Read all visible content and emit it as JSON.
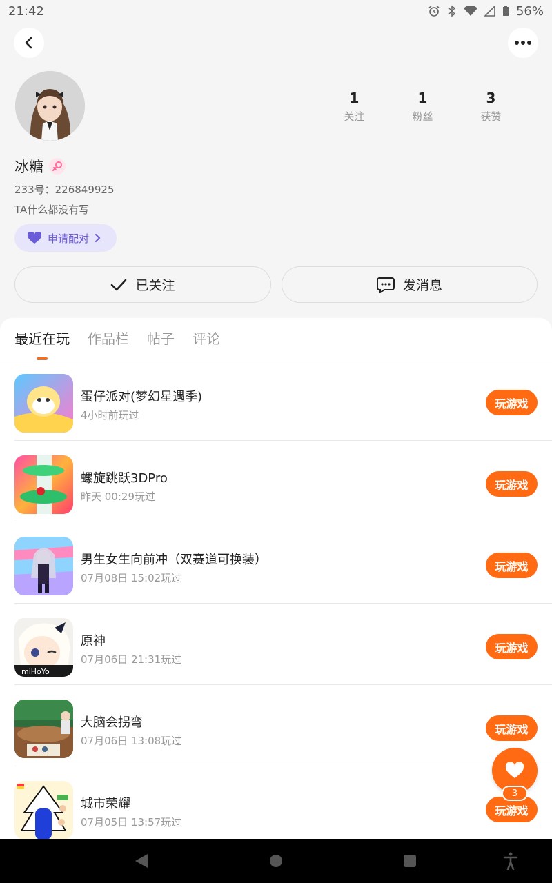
{
  "status_bar": {
    "time": "21:42",
    "battery": "56%"
  },
  "profile": {
    "username": "冰糖",
    "user_id": "233号：226849925",
    "bio": "TA什么都没有写",
    "pair_button": "申请配对",
    "stats": [
      {
        "value": "1",
        "label": "关注"
      },
      {
        "value": "1",
        "label": "粉丝"
      },
      {
        "value": "3",
        "label": "获赞"
      }
    ],
    "follow_button": "已关注",
    "message_button": "发消息"
  },
  "tabs": [
    {
      "label": "最近在玩",
      "active": true
    },
    {
      "label": "作品栏",
      "active": false
    },
    {
      "label": "帖子",
      "active": false
    },
    {
      "label": "评论",
      "active": false
    }
  ],
  "games": [
    {
      "name": "蛋仔派对(梦幻星遇季)",
      "time": "4小时前玩过",
      "button": "玩游戏"
    },
    {
      "name": "螺旋跳跃3DPro",
      "time": "昨天 00:29玩过",
      "button": "玩游戏"
    },
    {
      "name": "男生女生向前冲（双赛道可换装）",
      "time": "07月08日 15:02玩过",
      "button": "玩游戏"
    },
    {
      "name": "原神",
      "time": "07月06日 21:31玩过",
      "button": "玩游戏"
    },
    {
      "name": "大脑会拐弯",
      "time": "07月06日 13:08玩过",
      "button": "玩游戏"
    },
    {
      "name": "城市荣耀",
      "time": "07月05日 13:57玩过",
      "button": "玩游戏"
    }
  ],
  "like_fab": {
    "count": "3"
  },
  "colors": {
    "accent": "#ff6a13",
    "pair": "#6a5bd8"
  }
}
